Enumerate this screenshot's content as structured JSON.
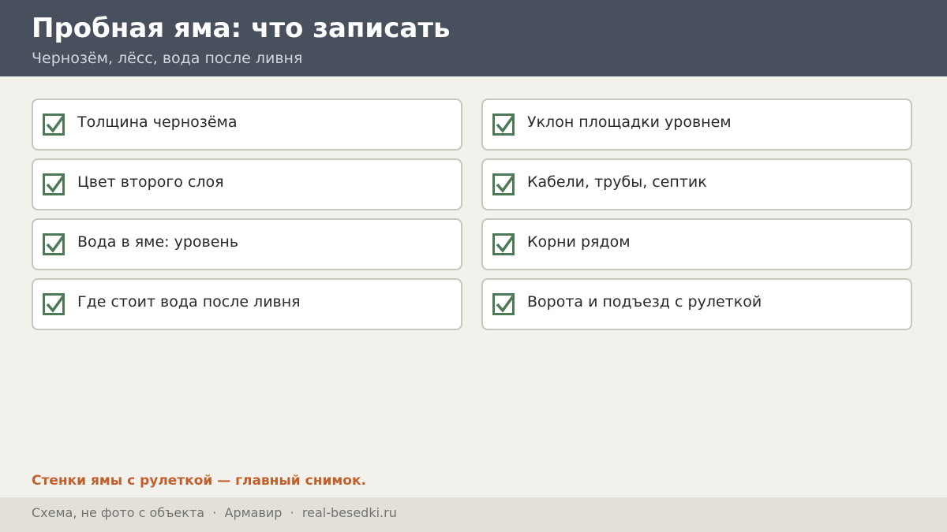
{
  "header": {
    "title": "Пробная яма: что записать",
    "subtitle": "Чернозём, лёсс, вода после ливня"
  },
  "checklist": {
    "check_icon": "checkbox-checked-icon",
    "check_color": "#4c7a56",
    "items": [
      {
        "label": "Толщина чернозёма",
        "checked": true
      },
      {
        "label": "Уклон площадки уровнем",
        "checked": true
      },
      {
        "label": "Цвет второго слоя",
        "checked": true
      },
      {
        "label": "Кабели, трубы, септик",
        "checked": true
      },
      {
        "label": "Вода в яме: уровень",
        "checked": true
      },
      {
        "label": "Корни рядом",
        "checked": true
      },
      {
        "label": "Где стоит вода после ливня",
        "checked": true
      },
      {
        "label": "Ворота и подъезд с рулеткой",
        "checked": true
      }
    ]
  },
  "note": "Стенки ямы с рулеткой — главный снимок.",
  "footer": {
    "text": "Схема, не фото с объекта  ·  Армавир  ·  real-besedki.ru"
  },
  "colors": {
    "header_bg": "#47505c",
    "accent_note": "#c0612d",
    "page_bg": "#f3f1ec"
  }
}
